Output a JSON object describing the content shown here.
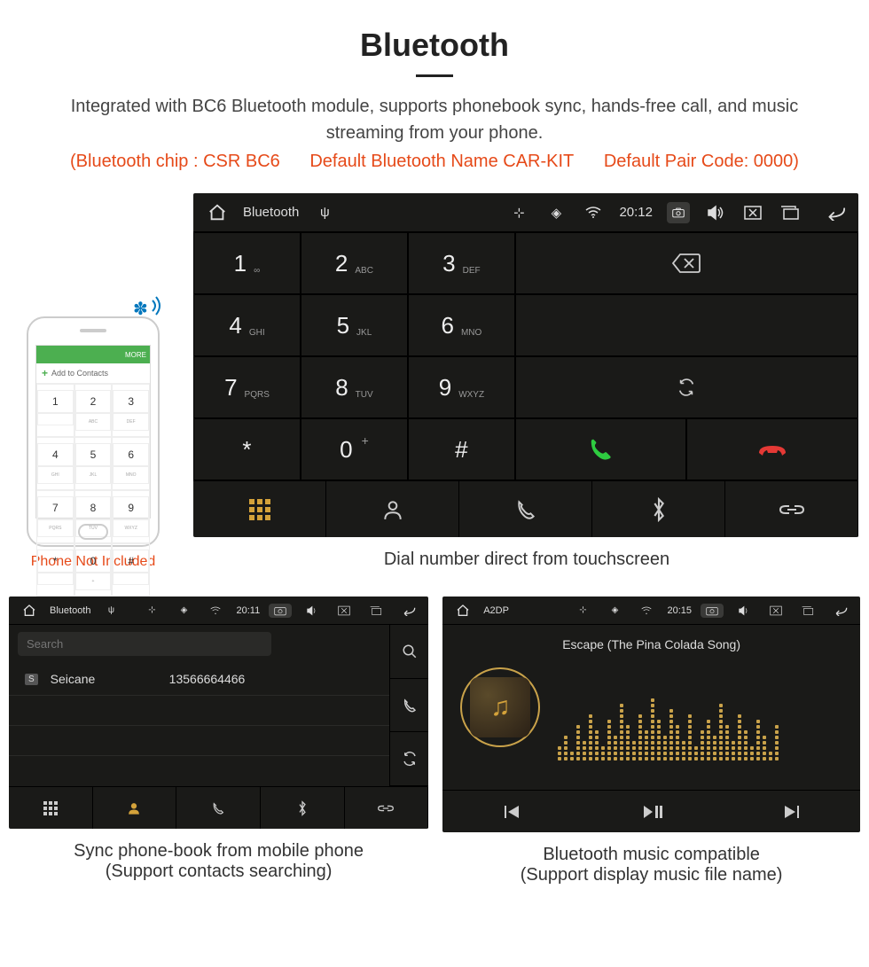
{
  "title": "Bluetooth",
  "description": "Integrated with BC6 Bluetooth module, supports phonebook sync, hands-free call, and music streaming from your phone.",
  "spec_chip": "(Bluetooth chip : CSR BC6",
  "spec_name": "Default Bluetooth Name CAR-KIT",
  "spec_code": "Default Pair Code: 0000)",
  "phone": {
    "topbar": "MORE",
    "add_label": "Add to Contacts",
    "note": "Phone Not Included",
    "keys": [
      {
        "d": "1",
        "l": ""
      },
      {
        "d": "2",
        "l": "ABC"
      },
      {
        "d": "3",
        "l": "DEF"
      },
      {
        "d": "4",
        "l": "GHI"
      },
      {
        "d": "5",
        "l": "JKL"
      },
      {
        "d": "6",
        "l": "MNO"
      },
      {
        "d": "7",
        "l": "PQRS"
      },
      {
        "d": "8",
        "l": "TUV"
      },
      {
        "d": "9",
        "l": "WXYZ"
      },
      {
        "d": "*",
        "l": ""
      },
      {
        "d": "0",
        "l": "+"
      },
      {
        "d": "#",
        "l": ""
      }
    ]
  },
  "hu_main": {
    "app": "Bluetooth",
    "time": "20:12",
    "keypad": [
      {
        "d": "1",
        "l": "∞"
      },
      {
        "d": "2",
        "l": "ABC"
      },
      {
        "d": "3",
        "l": "DEF"
      },
      {
        "d": "4",
        "l": "GHI"
      },
      {
        "d": "5",
        "l": "JKL"
      },
      {
        "d": "6",
        "l": "MNO"
      },
      {
        "d": "7",
        "l": "PQRS"
      },
      {
        "d": "8",
        "l": "TUV"
      },
      {
        "d": "9",
        "l": "WXYZ"
      },
      {
        "d": "*",
        "l": ""
      },
      {
        "d": "0",
        "l": "+",
        "sup": "+"
      },
      {
        "d": "#",
        "l": ""
      }
    ],
    "caption": "Dial number direct from touchscreen"
  },
  "hu_contacts": {
    "app": "Bluetooth",
    "time": "20:11",
    "search_placeholder": "Search",
    "contact_tag": "S",
    "contact_name": "Seicane",
    "contact_number": "13566664466",
    "caption_1": "Sync phone-book from mobile phone",
    "caption_2": "(Support contacts searching)"
  },
  "hu_music": {
    "app": "A2DP",
    "time": "20:15",
    "song": "Escape (The Pina Colada Song)",
    "caption_1": "Bluetooth music compatible",
    "caption_2": "(Support display music file name)"
  },
  "colors": {
    "accent": "#E64A19",
    "gold": "#D4A23A",
    "green": "#2ECC40"
  }
}
